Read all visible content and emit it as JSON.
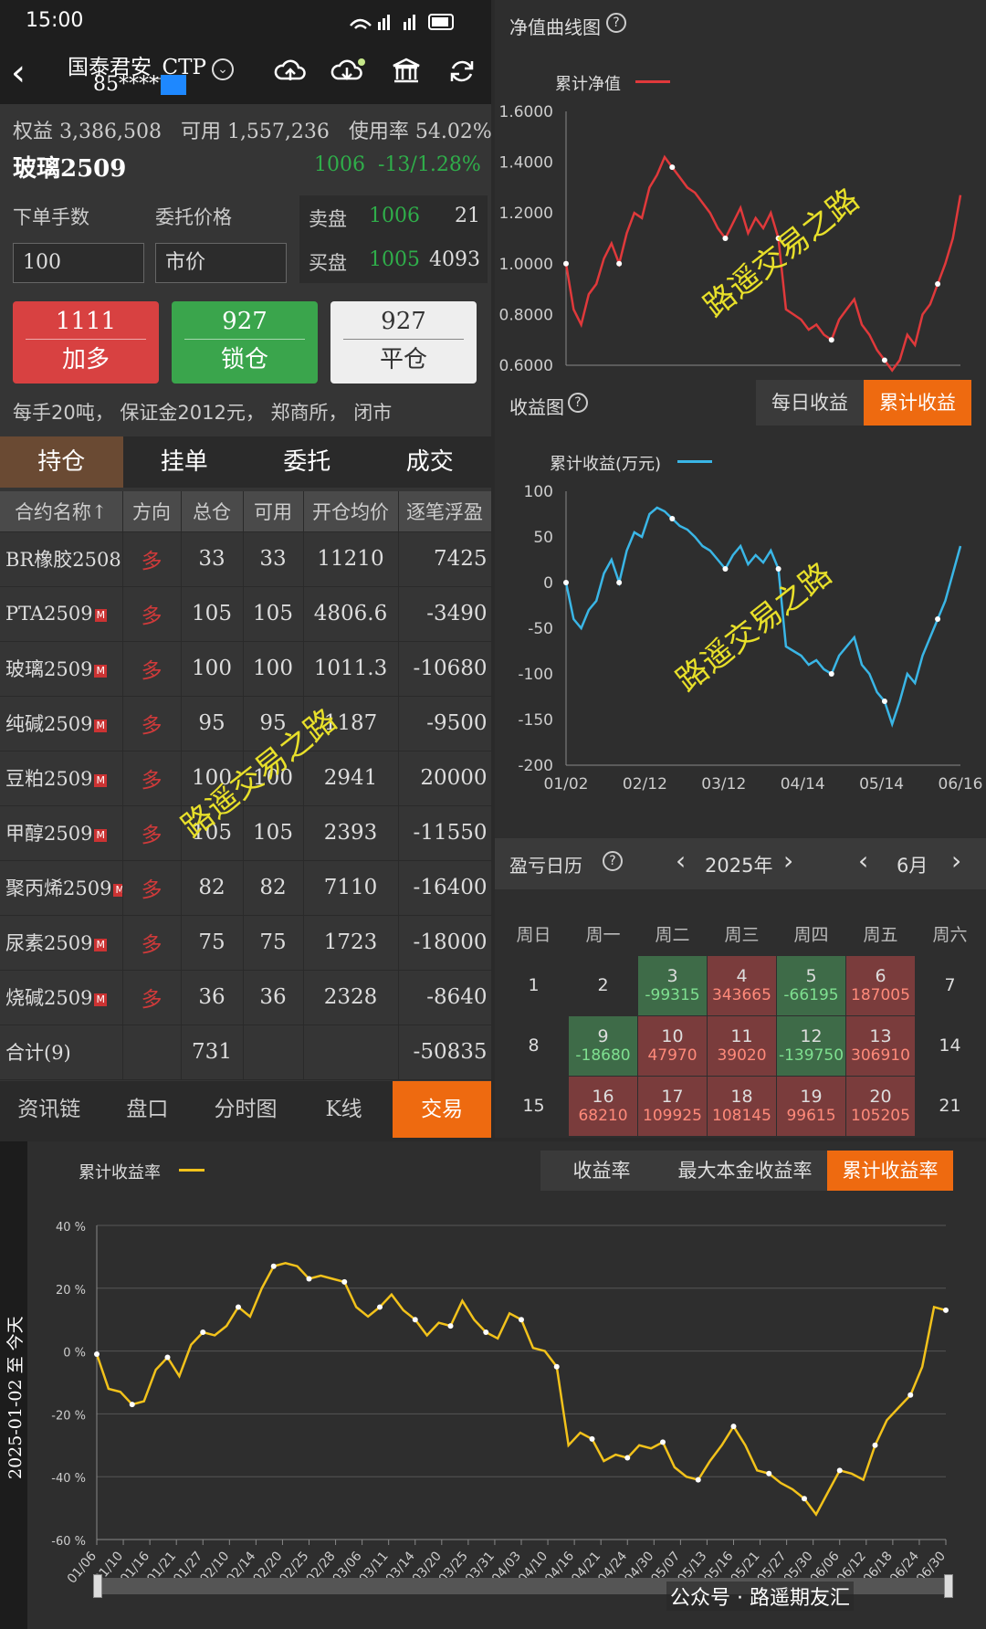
{
  "status": {
    "time": "15:00"
  },
  "header": {
    "account": "国泰君安_CTP",
    "account_id": "85****"
  },
  "summary": {
    "equity_text": "权益 3,386,508",
    "available_text": "可用 1,557,236",
    "usage_text": "使用率 54.02%"
  },
  "instrument": {
    "name": "玻璃2509",
    "price": "1006",
    "change": "-13/1.28%"
  },
  "order": {
    "qty_label": "下单手数",
    "price_label": "委托价格",
    "qty_value": "100",
    "price_value": "市价"
  },
  "book": {
    "ask_label": "卖盘",
    "ask_price": "1006",
    "ask_vol": "21",
    "bid_label": "买盘",
    "bid_price": "1005",
    "bid_vol": "4093"
  },
  "actions": [
    {
      "num": "1111",
      "label": "加多"
    },
    {
      "num": "927",
      "label": "锁仓"
    },
    {
      "num": "927",
      "label": "平仓"
    }
  ],
  "info": "每手20吨， 保证金2012元， 郑商所， 闭市",
  "tabs": [
    "持仓",
    "挂单",
    "委托",
    "成交"
  ],
  "positions": {
    "headers": [
      "合约名称↑",
      "方向",
      "总仓",
      "可用",
      "开仓均价",
      "逐笔浮盈"
    ],
    "rows": [
      {
        "name": "BR橡胶2508",
        "dir": "多",
        "total": "33",
        "avail": "33",
        "avg": "11210",
        "pnl": "7425",
        "pos": true
      },
      {
        "name": "PTA2509",
        "dir": "多",
        "total": "105",
        "avail": "105",
        "avg": "4806.6",
        "pnl": "-3490",
        "pos": false
      },
      {
        "name": "玻璃2509",
        "dir": "多",
        "total": "100",
        "avail": "100",
        "avg": "1011.3",
        "pnl": "-10680",
        "pos": false
      },
      {
        "name": "纯碱2509",
        "dir": "多",
        "total": "95",
        "avail": "95",
        "avg": "1187",
        "pnl": "-9500",
        "pos": false
      },
      {
        "name": "豆粕2509",
        "dir": "多",
        "total": "100",
        "avail": "100",
        "avg": "2941",
        "pnl": "20000",
        "pos": true
      },
      {
        "name": "甲醇2509",
        "dir": "多",
        "total": "105",
        "avail": "105",
        "avg": "2393",
        "pnl": "-11550",
        "pos": false
      },
      {
        "name": "聚丙烯2509",
        "dir": "多",
        "total": "82",
        "avail": "82",
        "avg": "7110",
        "pnl": "-16400",
        "pos": false
      },
      {
        "name": "尿素2509",
        "dir": "多",
        "total": "75",
        "avail": "75",
        "avg": "1723",
        "pnl": "-18000",
        "pos": false
      },
      {
        "name": "烧碱2509",
        "dir": "多",
        "total": "36",
        "avail": "36",
        "avg": "2328",
        "pnl": "-8640",
        "pos": false
      }
    ],
    "total": {
      "name": "合计(9)",
      "total": "731",
      "pnl": "-50835"
    }
  },
  "bottom_nav": [
    "资讯链",
    "盘口",
    "分时图",
    "K线",
    "交易"
  ],
  "watermark": "路遥交易之路",
  "nav_chart": {
    "title": "净值曲线图",
    "legend": "累计净值",
    "color": "#e0393b"
  },
  "income": {
    "title": "收益图",
    "btn_daily": "每日收益",
    "btn_cum": "累计收益",
    "legend": "累计收益(万元)",
    "color": "#3ab6e6"
  },
  "calendar": {
    "title": "盈亏日历",
    "year": "2025年",
    "month": "6月",
    "weekdays": [
      "周日",
      "周一",
      "周二",
      "周三",
      "周四",
      "周五",
      "周六"
    ],
    "rows": [
      [
        {
          "d": "1"
        },
        {
          "d": "2"
        },
        {
          "d": "3",
          "v": "-99315",
          "c": "g"
        },
        {
          "d": "4",
          "v": "343665",
          "c": "r"
        },
        {
          "d": "5",
          "v": "-66195",
          "c": "g"
        },
        {
          "d": "6",
          "v": "187005",
          "c": "r"
        },
        {
          "d": "7"
        }
      ],
      [
        {
          "d": "8"
        },
        {
          "d": "9",
          "v": "-18680",
          "c": "g"
        },
        {
          "d": "10",
          "v": "47970",
          "c": "r"
        },
        {
          "d": "11",
          "v": "39020",
          "c": "r"
        },
        {
          "d": "12",
          "v": "-139750",
          "c": "g"
        },
        {
          "d": "13",
          "v": "306910",
          "c": "r"
        },
        {
          "d": "14"
        }
      ],
      [
        {
          "d": "15"
        },
        {
          "d": "16",
          "v": "68210",
          "c": "r"
        },
        {
          "d": "17",
          "v": "109925",
          "c": "r"
        },
        {
          "d": "18",
          "v": "108145",
          "c": "r"
        },
        {
          "d": "19",
          "v": "99615",
          "c": "r"
        },
        {
          "d": "20",
          "v": "105205",
          "c": "r"
        },
        {
          "d": "21"
        }
      ]
    ]
  },
  "rate": {
    "legend": "累计收益率",
    "btns": [
      "收益率",
      "最大本金收益率",
      "累计收益率"
    ],
    "side_label": "2025-01-02 至 今天",
    "color": "#f2c21b"
  },
  "footer": {
    "text": "公众号 · 路遥期友汇"
  },
  "chart_data": [
    {
      "type": "line",
      "name": "净值曲线图",
      "legend": "累计净值",
      "ylim": [
        0.6,
        1.6
      ],
      "yticks": [
        "1.6000",
        "1.4000",
        "1.2000",
        "1.0000",
        "0.8000",
        "0.6000"
      ],
      "values": [
        1.0,
        0.82,
        0.76,
        0.88,
        0.92,
        1.02,
        1.08,
        1.0,
        1.12,
        1.2,
        1.18,
        1.3,
        1.35,
        1.42,
        1.38,
        1.34,
        1.3,
        1.28,
        1.24,
        1.2,
        1.14,
        1.1,
        1.16,
        1.22,
        1.12,
        1.18,
        1.14,
        1.2,
        1.1,
        0.82,
        0.8,
        0.78,
        0.74,
        0.76,
        0.72,
        0.7,
        0.78,
        0.82,
        0.86,
        0.76,
        0.72,
        0.66,
        0.62,
        0.58,
        0.62,
        0.72,
        0.68,
        0.8,
        0.84,
        0.92,
        1.0,
        1.1,
        1.27
      ]
    },
    {
      "type": "line",
      "name": "收益图",
      "legend": "累计收益(万元)",
      "ylim": [
        -200,
        100
      ],
      "yticks": [
        "100",
        "50",
        "0",
        "-50",
        "-100",
        "-150",
        "-200"
      ],
      "xticks": [
        "01/02",
        "02/12",
        "03/12",
        "04/14",
        "05/14",
        "06/16"
      ],
      "values": [
        0,
        -40,
        -50,
        -30,
        -20,
        10,
        25,
        0,
        35,
        55,
        50,
        75,
        82,
        78,
        70,
        62,
        58,
        50,
        40,
        35,
        25,
        15,
        30,
        40,
        20,
        30,
        22,
        35,
        15,
        -70,
        -75,
        -80,
        -90,
        -85,
        -95,
        -100,
        -80,
        -70,
        -60,
        -90,
        -100,
        -120,
        -130,
        -155,
        -130,
        -100,
        -110,
        -80,
        -60,
        -40,
        -20,
        10,
        40
      ]
    },
    {
      "type": "line",
      "name": "累计收益率",
      "legend": "累计收益率",
      "ylim": [
        -60,
        40
      ],
      "yticks": [
        "40 %",
        "20 %",
        "0 %",
        "-20 %",
        "-40 %",
        "-60 %"
      ],
      "xticks": [
        "01/06",
        "01/10",
        "01/16",
        "01/21",
        "01/27",
        "02/10",
        "02/14",
        "02/20",
        "02/25",
        "02/28",
        "03/06",
        "03/11",
        "03/14",
        "03/20",
        "03/25",
        "03/31",
        "04/03",
        "04/10",
        "04/16",
        "04/21",
        "04/24",
        "04/30",
        "05/07",
        "05/13",
        "05/16",
        "05/21",
        "05/27",
        "05/30",
        "06/06",
        "06/12",
        "06/18",
        "06/24",
        "06/30"
      ],
      "values": [
        -1,
        -12,
        -13,
        -17,
        -16,
        -6,
        -2,
        -8,
        2,
        6,
        5,
        8,
        14,
        11,
        20,
        27,
        28,
        27,
        23,
        24,
        23,
        22,
        14,
        11,
        14,
        18,
        13,
        10,
        5,
        9,
        8,
        16,
        10,
        6,
        4,
        12,
        10,
        1,
        0,
        -5,
        -30,
        -26,
        -28,
        -35,
        -33,
        -34,
        -30,
        -31,
        -29,
        -37,
        -40,
        -41,
        -35,
        -30,
        -24,
        -30,
        -38,
        -39,
        -42,
        -44,
        -47,
        -52,
        -45,
        -38,
        -39,
        -41,
        -30,
        -22,
        -18,
        -14,
        -5,
        14,
        13
      ]
    }
  ]
}
